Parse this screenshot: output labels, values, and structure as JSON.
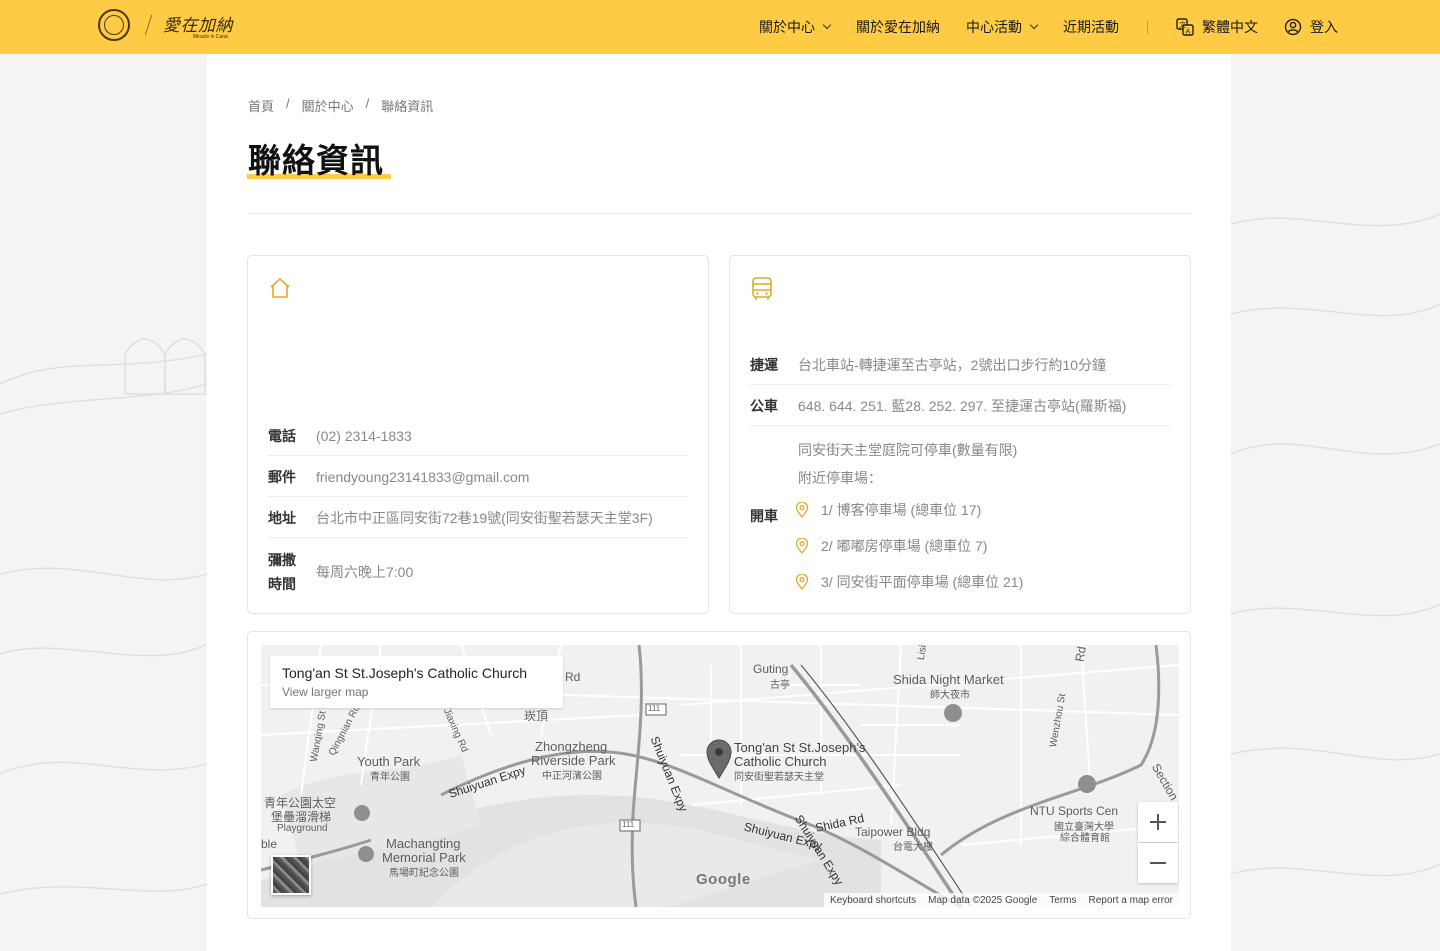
{
  "header": {
    "logo_main": "愛在加納",
    "logo_sub": "Miracle in Canà",
    "nav": [
      {
        "label": "關於中心",
        "dropdown": true
      },
      {
        "label": "關於愛在加納",
        "dropdown": false
      },
      {
        "label": "中心活動",
        "dropdown": true
      },
      {
        "label": "近期活動",
        "dropdown": false
      }
    ],
    "language": "繁體中文",
    "login": "登入"
  },
  "breadcrumb": [
    "首頁",
    "關於中心",
    "聯絡資訊"
  ],
  "page_title": "聯絡資訊",
  "contact": {
    "icon": "home-icon",
    "rows": [
      {
        "label": "電話",
        "value": "(02) 2314-1833"
      },
      {
        "label": "郵件",
        "value": "friendyoung23141833@gmail.com"
      },
      {
        "label": "地址",
        "value": "台北市中正區同安街72巷19號(同安街聖若瑟天主堂3F)"
      },
      {
        "label_line1": "彌撒",
        "label_line2": "時間",
        "value": "每周六晚上7:00"
      }
    ]
  },
  "transport": {
    "icon": "bus-icon",
    "mrt": {
      "label": "捷運",
      "value": "台北車站-轉捷運至古亭站，2號出口步行約10分鐘"
    },
    "bus": {
      "label": "公車",
      "value": "648. 644. 251. 藍28. 252. 297. 至捷運古亭站(羅斯福)"
    },
    "car": {
      "label": "開車",
      "line1": "同安街天主堂庭院可停車(數量有限)",
      "line2": "附近停車場：",
      "lots": [
        "1/ 博客停車場 (總車位 17)",
        "2/ 嘟嘟房停車場 (總車位 7)",
        "3/ 同安街平面停車場 (總車位 21)"
      ]
    }
  },
  "map": {
    "info_title": "Tong'an St St.Joseph's Catholic Church",
    "info_link": "View larger map",
    "marker_line1": "Tong'an St St.Joseph's",
    "marker_line2": "Catholic Church",
    "marker_line3": "同安街聖若瑟天主堂",
    "labels": {
      "guting": "Guting",
      "guting_zh": "古亭",
      "shida": "Shida Night Market",
      "shida_zh": "師大夜市",
      "youth_park": "Youth Park",
      "youth_park_zh": "青年公園",
      "zhongzheng": "Zhongzheng",
      "riverside": "Riverside Park",
      "riverside_zh": "中正河濱公園",
      "shuiyuan": "Shuiyuan Expy",
      "shuiyuan2": "Shuiyuan Expy",
      "shuiyuan3": "Shuiyuan Expy",
      "shuiyuan_r": "Shuiyuan Expy",
      "machangting1": "Machangting",
      "machangting2": "Memorial Park",
      "machangting_zh": "馬場町紀念公園",
      "playground1": "青年公園太空",
      "playground2": "堡壘溜滑梯",
      "playground3": "Playground",
      "shida_rd": "Shida Rd",
      "taipower": "Taipower Bldg",
      "taipower_zh": "台電大樓",
      "ntu1": "NTU Sports Cen",
      "ntu2": "國立臺灣大學",
      "ntu3": "綜合體育館",
      "wenzhou": "Wenzhou St",
      "wanqing": "Wanqing St",
      "qinglian": "Qingnian Rd",
      "jiaxing": "Jiaxing Rd",
      "kanding": "崁頂",
      "shield": "111",
      "section": "Section",
      "rd": "Rd",
      "lisi": "Lisi",
      "ble": "ble",
      "rd2": "Rd"
    },
    "google": "Google",
    "attribution": [
      "Keyboard shortcuts",
      "Map data ©2025 Google",
      "Terms",
      "Report a map error"
    ]
  }
}
